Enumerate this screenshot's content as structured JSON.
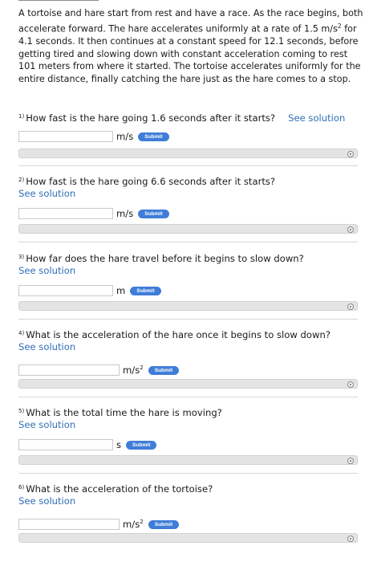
{
  "intro": {
    "part1": "A tortoise and hare start from rest and have a race. As the race begins, both accelerate forward. The hare accelerates uniformly at a rate of 1.5 m/s",
    "sup": "2",
    "part2": " for 4.1 seconds. It then continues at a constant speed for 12.1 seconds, before getting tired and slowing down with constant acceleration coming to rest 101 meters from where it started. The tortoise accelerates uniformly for the entire distance, finally catching the hare just as the hare comes to a stop."
  },
  "submit_label": "Submit",
  "see_solution": "See solution",
  "questions": [
    {
      "number": "1)",
      "text": "How fast is the hare going 1.6 seconds after it starts?",
      "unit": "m/s",
      "unit_sup": "",
      "input_value": ""
    },
    {
      "number": "2)",
      "text": "How fast is the hare going 6.6 seconds after it starts?",
      "unit": "m/s",
      "unit_sup": "",
      "input_value": ""
    },
    {
      "number": "3)",
      "text": "How far does the hare travel before it begins to slow down?",
      "unit": "m",
      "unit_sup": "",
      "input_value": ""
    },
    {
      "number": "4)",
      "text": "What is the acceleration of the hare once it begins to slow down?",
      "unit": "m/s",
      "unit_sup": "2",
      "input_value": ""
    },
    {
      "number": "5)",
      "text": "What is the total time the hare is moving?",
      "unit": "s",
      "unit_sup": "",
      "input_value": ""
    },
    {
      "number": "6)",
      "text": "What is the acceleration of the tortoise?",
      "unit": "m/s",
      "unit_sup": "2",
      "input_value": ""
    }
  ]
}
